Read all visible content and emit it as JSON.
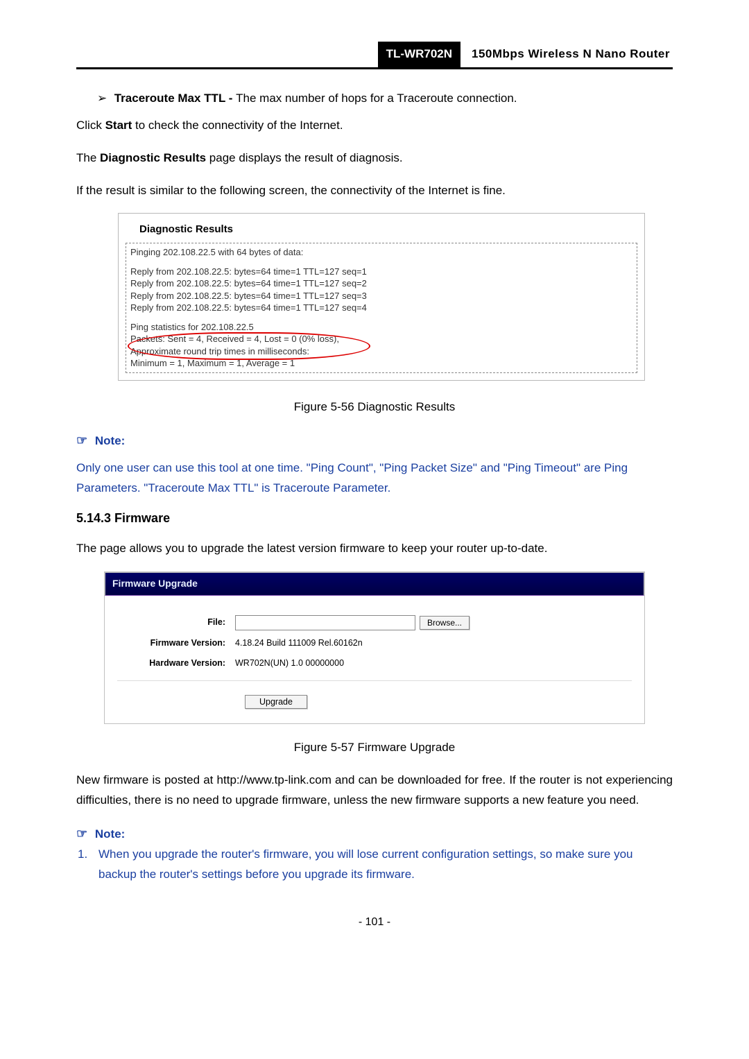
{
  "header": {
    "model": "TL-WR702N",
    "desc": "150Mbps  Wireless  N  Nano  Router"
  },
  "traceroute": {
    "label": "Traceroute Max TTL - ",
    "desc": "The max number of hops for a Traceroute connection."
  },
  "p_start_prefix": "Click ",
  "p_start_bold": "Start",
  "p_start_suffix": " to check the connectivity of the Internet.",
  "p_diagresults_prefix": "The ",
  "p_diagresults_bold": "Diagnostic Results",
  "p_diagresults_suffix": " page displays the result of diagnosis.",
  "p_similar": "If the result is similar to the following screen, the connectivity of the Internet is fine.",
  "diag": {
    "title": "Diagnostic Results",
    "ping_header": "Pinging 202.108.22.5 with 64 bytes of data:",
    "replies": [
      "Reply from 202.108.22.5:  bytes=64  time=1  TTL=127  seq=1",
      "Reply from 202.108.22.5:  bytes=64  time=1  TTL=127  seq=2",
      "Reply from 202.108.22.5:  bytes=64  time=1  TTL=127  seq=3",
      "Reply from 202.108.22.5:  bytes=64  time=1  TTL=127  seq=4"
    ],
    "stats_header": "Ping statistics for 202.108.22.5",
    "packets": "  Packets: Sent = 4, Received = 4, Lost = 0 (0% loss),",
    "approx": "Approximate round trip times in milliseconds:",
    "minmax": "  Minimum = 1, Maximum = 1, Average = 1"
  },
  "fig56": "Figure 5-56    Diagnostic Results",
  "note_label": "Note:",
  "note1_body": "Only one user can use this tool at one time. \"Ping Count\", \"Ping Packet Size\" and \"Ping Timeout\" are Ping Parameters. \"Traceroute Max TTL\" is Traceroute Parameter.",
  "section_firmware": "5.14.3  Firmware",
  "p_firmware": "The page allows you to upgrade the latest version firmware to keep your router up-to-date.",
  "fw": {
    "title": "Firmware Upgrade",
    "file_label": "File:",
    "browse": "Browse...",
    "fw_ver_label": "Firmware Version:",
    "fw_ver_value": "4.18.24 Build 111009 Rel.60162n",
    "hw_ver_label": "Hardware Version:",
    "hw_ver_value": "WR702N(UN) 1.0 00000000",
    "upgrade": "Upgrade"
  },
  "fig57": "Figure 5-57 Firmware Upgrade",
  "p_newfw": "New firmware is posted at http://www.tp-link.com and can be downloaded for free. If the router is not experiencing difficulties, there is no need to upgrade firmware, unless the new firmware supports a new feature you need.",
  "note2_num": "1.",
  "note2_body": "When you upgrade the router's firmware, you will lose current configuration settings, so make sure you backup the router's settings before you upgrade its firmware.",
  "page_num": "- 101 -"
}
